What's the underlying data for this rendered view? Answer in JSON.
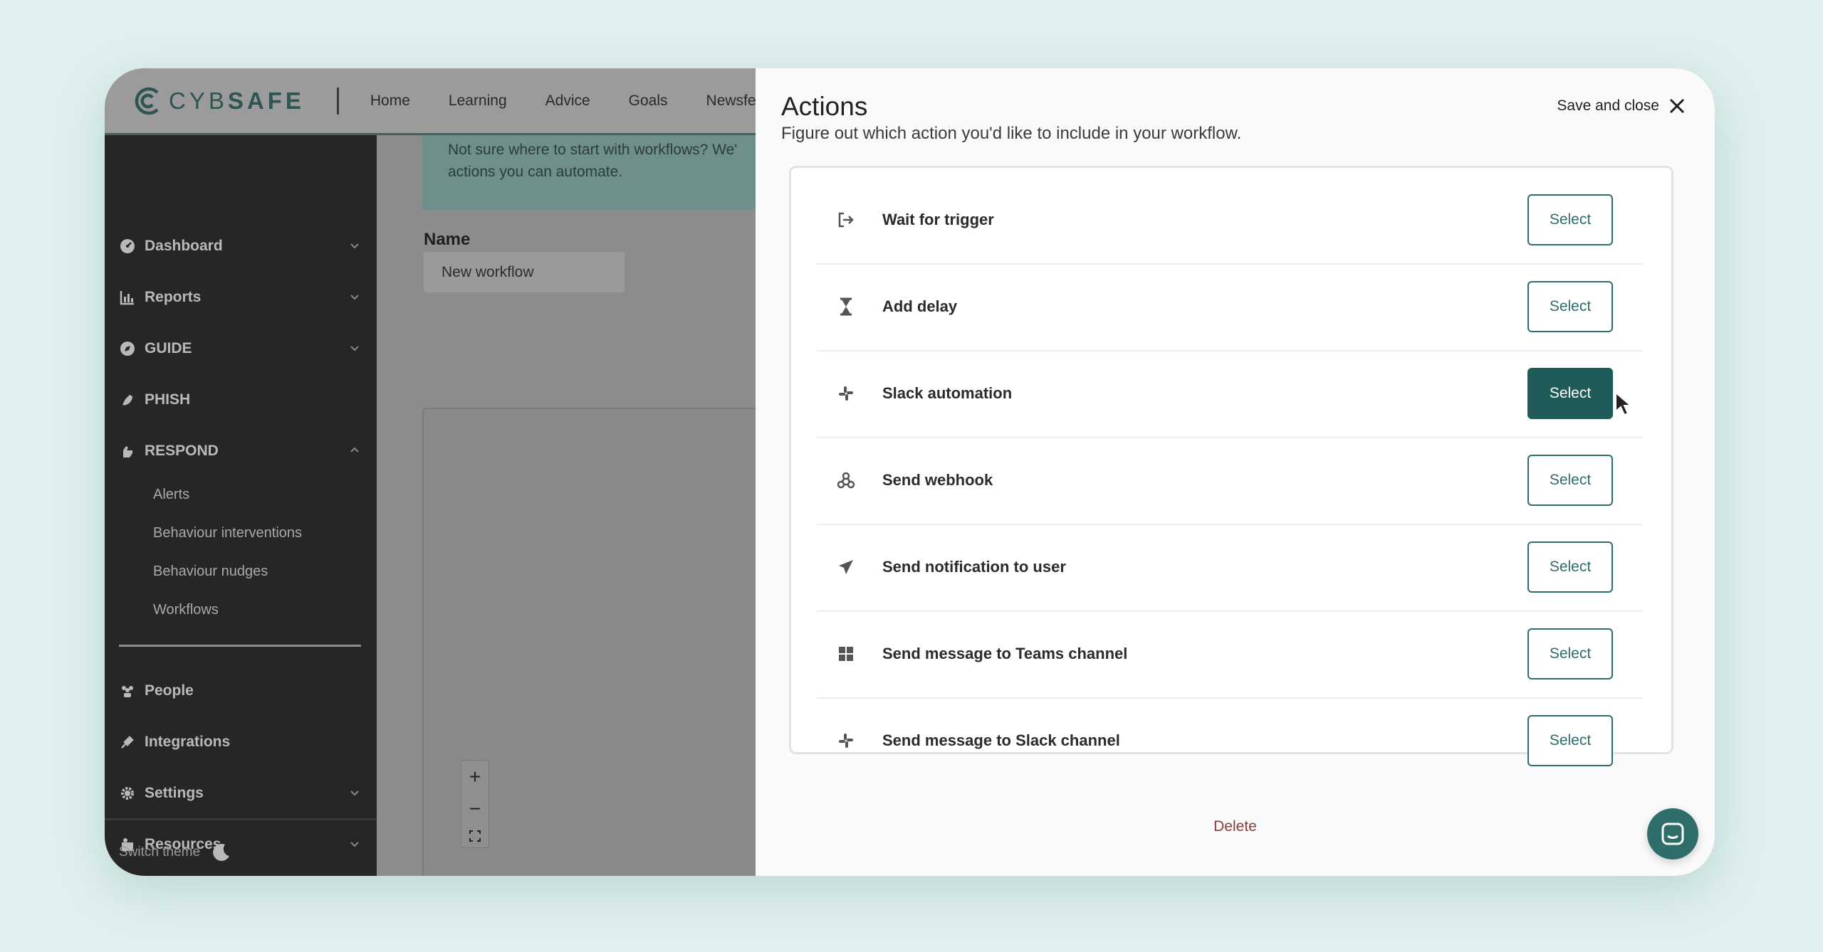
{
  "header": {
    "logo_text_a": "CYB",
    "logo_text_b": "SAFE",
    "nav": [
      "Home",
      "Learning",
      "Advice",
      "Goals",
      "Newsfeed"
    ]
  },
  "sidebar": {
    "items": [
      {
        "label": "Dashboard",
        "icon": "gauge-icon"
      },
      {
        "label": "Reports",
        "icon": "chart-icon"
      },
      {
        "label": "GUIDE",
        "icon": "compass-icon"
      },
      {
        "label": "PHISH",
        "icon": "hook-icon"
      },
      {
        "label": "RESPOND",
        "icon": "hand-icon"
      }
    ],
    "respond_sub": [
      "Alerts",
      "Behaviour interventions",
      "Behaviour nudges",
      "Workflows"
    ],
    "bottom_items": [
      {
        "label": "People",
        "icon": "people-icon"
      },
      {
        "label": "Integrations",
        "icon": "plug-icon"
      },
      {
        "label": "Settings",
        "icon": "gear-icon"
      },
      {
        "label": "Resources",
        "icon": "book-icon"
      }
    ],
    "switch_theme": "Switch theme"
  },
  "main": {
    "banner_line1": "Not sure where to start with workflows? We'",
    "banner_line2": "actions you can automate.",
    "name_label": "Name",
    "name_value": "New workflow"
  },
  "panel": {
    "title": "Actions",
    "subtitle": "Figure out which action you'd like to include in your workflow.",
    "save_close": "Save and close",
    "delete": "Delete",
    "actions": [
      {
        "label": "Wait for trigger",
        "icon": "sign-out-icon",
        "button": "Select"
      },
      {
        "label": "Add delay",
        "icon": "hourglass-icon",
        "button": "Select"
      },
      {
        "label": "Slack automation",
        "icon": "slack-icon",
        "button": "Select"
      },
      {
        "label": "Send webhook",
        "icon": "webhook-icon",
        "button": "Select"
      },
      {
        "label": "Send notification to user",
        "icon": "paper-plane-icon",
        "button": "Select"
      },
      {
        "label": "Send message to Teams channel",
        "icon": "windows-icon",
        "button": "Select"
      },
      {
        "label": "Send message to Slack channel",
        "icon": "slack-icon",
        "button": "Select"
      }
    ]
  },
  "colors": {
    "accent": "#1f5b58",
    "sidebar_bg": "#262626",
    "delete": "#8a3b3b"
  }
}
